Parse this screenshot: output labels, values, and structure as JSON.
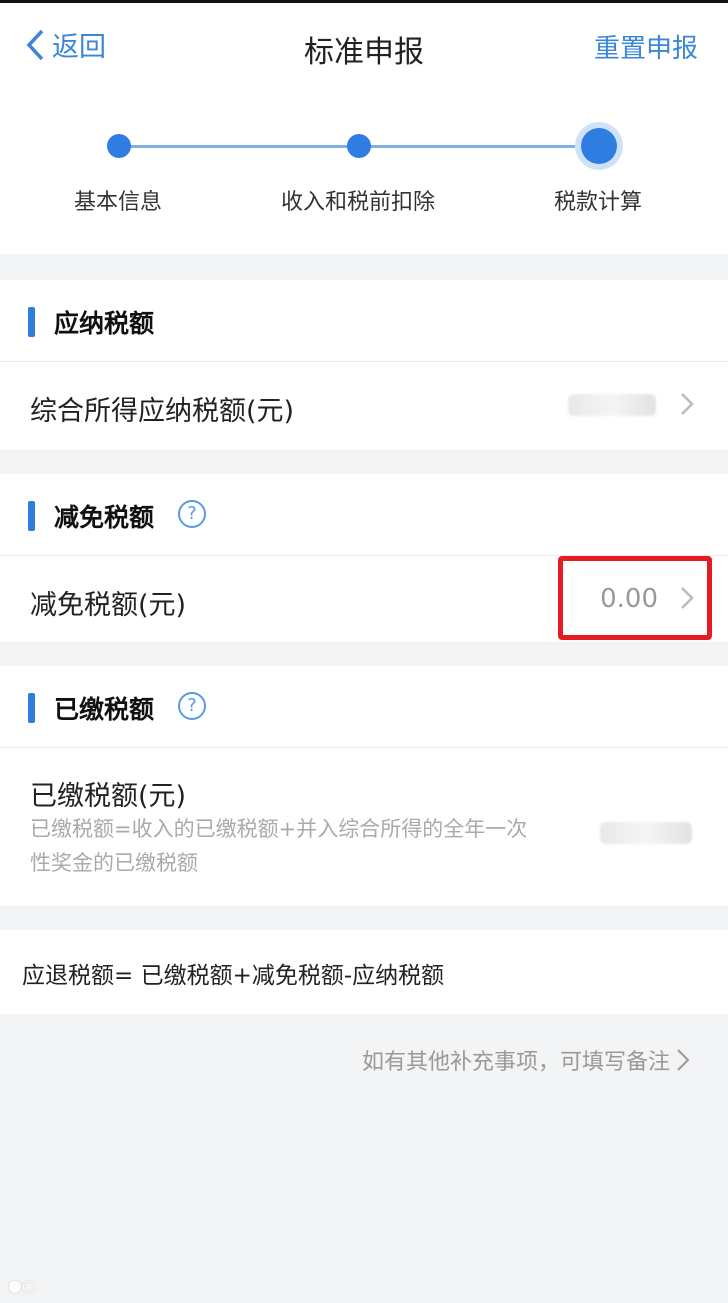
{
  "header": {
    "back_label": "返回",
    "title": "标准申报",
    "reset_label": "重置申报"
  },
  "steps": {
    "items": [
      "基本信息",
      "收入和税前扣除",
      "税款计算"
    ]
  },
  "sections": {
    "payable": {
      "title": "应纳税额",
      "row_label": "综合所得应纳税额(元)"
    },
    "reduction": {
      "title": "减免税额",
      "row_label": "减免税额(元)",
      "value": "0.00"
    },
    "paid": {
      "title": "已缴税额",
      "row_label": "已缴税额(元)",
      "sub_line1": "已缴税额=收入的已缴税额+并入综合所得的全年一次",
      "sub_line2": "性奖金的已缴税额"
    }
  },
  "formula": "应退税额= 已缴税额+减免税额-应纳税额",
  "note": "如有其他补充事项，可填写备注",
  "colors": {
    "accent": "#2f7de1",
    "highlight": "#e51c23"
  }
}
